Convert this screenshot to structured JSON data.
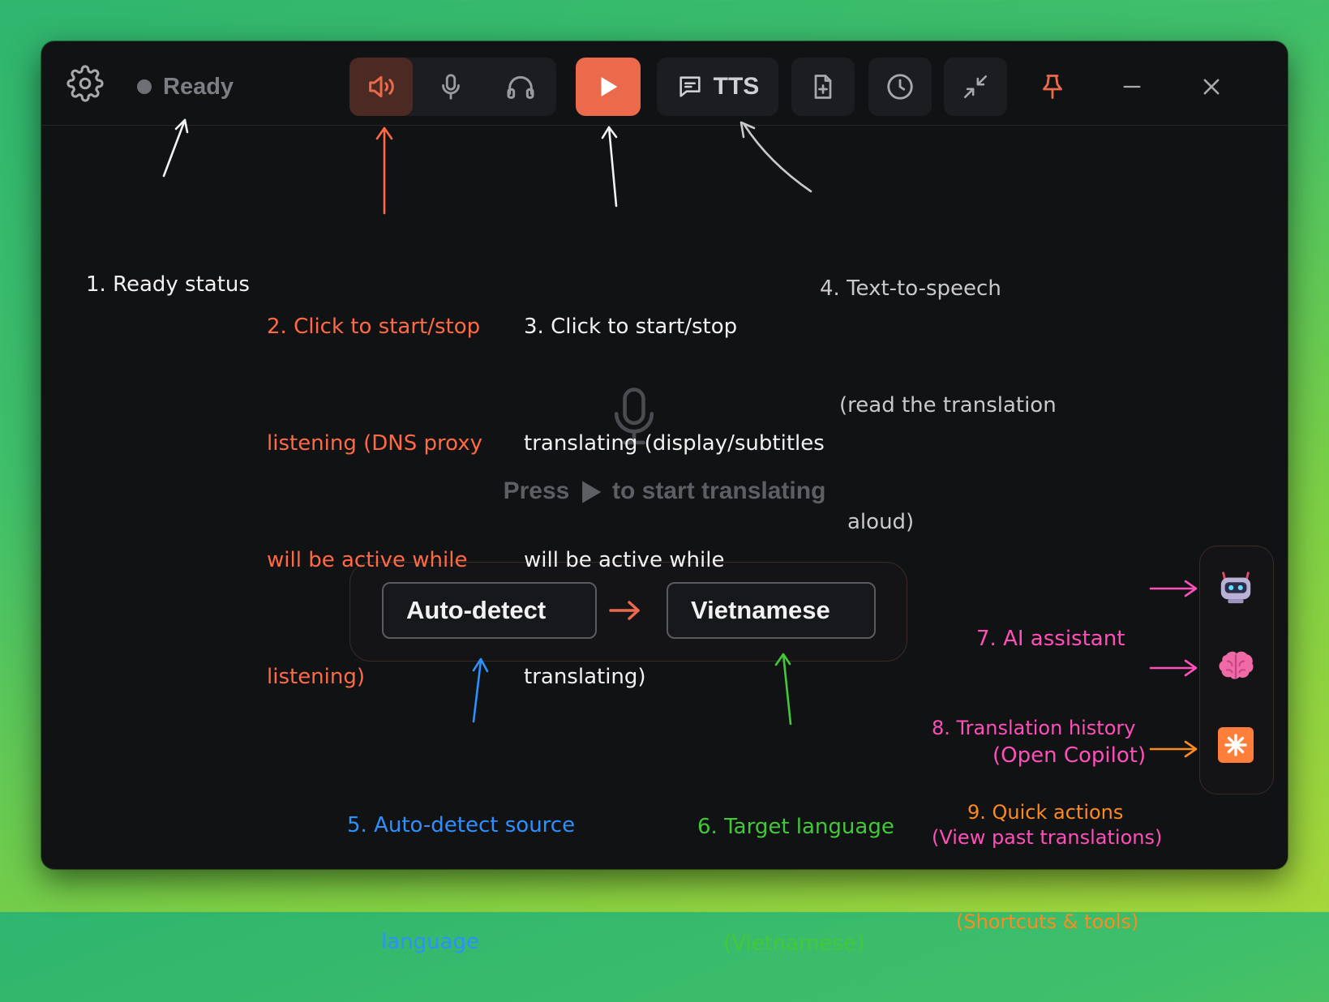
{
  "toolbar": {
    "settings_icon": "gear-icon",
    "status_text": "Ready",
    "speaker_icon": "speaker-icon",
    "mic_icon": "microphone-icon",
    "headphones_icon": "headphones-icon",
    "play_icon": "play-icon",
    "tts_label": "TTS",
    "tts_icon": "message-icon",
    "file_icon": "file-add-icon",
    "history_icon": "clock-icon",
    "collapse_icon": "collapse-icon",
    "pin_icon": "pin-icon",
    "minimize_icon": "minimize-icon",
    "close_icon": "close-icon"
  },
  "main": {
    "hint_before": "Press",
    "hint_after": "to start translating"
  },
  "languages": {
    "source": "Auto-detect",
    "target": "Vietnamese"
  },
  "side_actions": [
    "robot-icon",
    "brain-icon",
    "sparkle-icon"
  ],
  "annotations": {
    "a1": [
      "1. Ready status"
    ],
    "a2": [
      "2. Click to start/stop",
      "listening (DNS proxy",
      "will be active while",
      "listening)"
    ],
    "a3": [
      "3. Click to start/stop",
      "translating (display/subtitles",
      "will be active while",
      "translating)"
    ],
    "a4": [
      "4. Text-to-speech",
      "(read the translation",
      "aloud)"
    ],
    "a5": [
      "5. Auto-detect source",
      "language"
    ],
    "a6": [
      "6. Target language",
      "(Vietnamese)"
    ],
    "a7": [
      "7. AI assistant",
      "(Open Copilot)"
    ],
    "a8": [
      "8. Translation history",
      "(View past translations)"
    ],
    "a9": [
      "9. Quick actions",
      "(Shortcuts & tools)"
    ]
  },
  "colors": {
    "accent": "#ea6a4b",
    "note_white": "#f2f2f2",
    "note_orange": "#ff6a44",
    "note_gray": "#c9c9cc",
    "note_blue": "#2e8fff",
    "note_green": "#43c83a",
    "note_pink": "#ff4fb8",
    "note_amber": "#ff8a1e"
  }
}
